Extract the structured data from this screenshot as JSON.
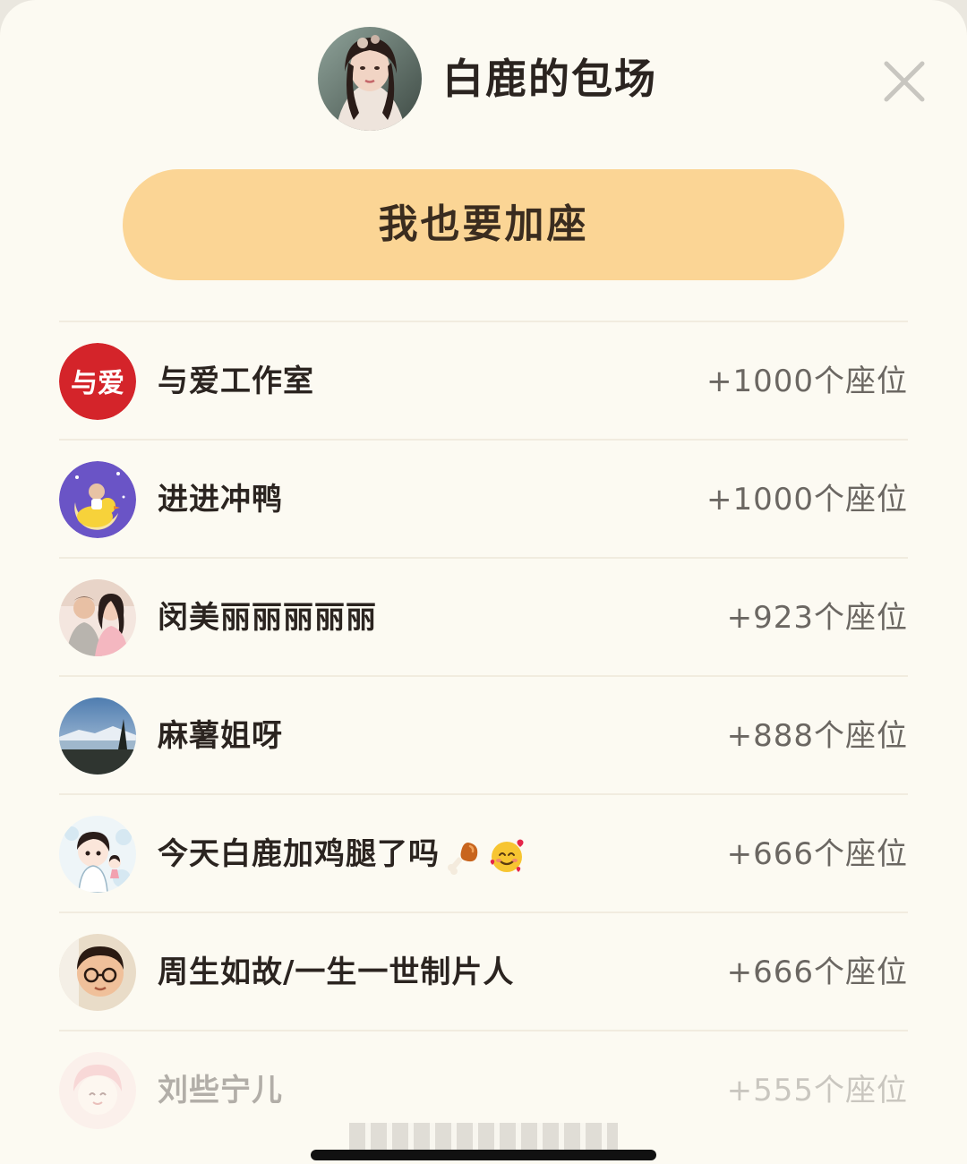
{
  "header": {
    "title": "白鹿的包场",
    "avatar_icon": "host-avatar-portrait",
    "close_icon": "close-icon"
  },
  "join_button": {
    "label": "我也要加座"
  },
  "contributors": [
    {
      "name": "与爱工作室",
      "seats": "+1000个座位",
      "avatar": "yuai-logo",
      "avatar_text": "与爱",
      "avatar_color": "#d4242a"
    },
    {
      "name": "进进冲鸭",
      "seats": "+1000个座位",
      "avatar": "moon-duck-avatar",
      "avatar_color": "#6a54c6"
    },
    {
      "name": "闵美丽丽丽丽丽",
      "seats": "+923个座位",
      "avatar": "couple-photo-avatar",
      "avatar_color": "#f2c9c4"
    },
    {
      "name": "麻薯姐呀",
      "seats": "+888个座位",
      "avatar": "landscape-avatar",
      "avatar_color": "#5a7fa8"
    },
    {
      "name": "今天白鹿加鸡腿了吗",
      "seats": "+666个座位",
      "avatar": "cartoon-girl-avatar",
      "avatar_color": "#d6e8f2",
      "emojis": [
        "drumstick-emoji",
        "smiling-face-with-hearts-emoji"
      ]
    },
    {
      "name": "周生如故/一生一世制片人",
      "seats": "+666个座位",
      "avatar": "boy-glasses-avatar",
      "avatar_color": "#e9b88a"
    },
    {
      "name": "刘些宁儿",
      "seats": "+555个座位",
      "avatar": "pink-cartoon-avatar",
      "avatar_color": "#f6c6c6"
    }
  ],
  "colors": {
    "sheet_background": "#fcfaf2",
    "button_background": "#fbd595",
    "divider": "#f1ecdf",
    "text_primary": "#2b2420",
    "text_secondary": "#6b6762"
  }
}
